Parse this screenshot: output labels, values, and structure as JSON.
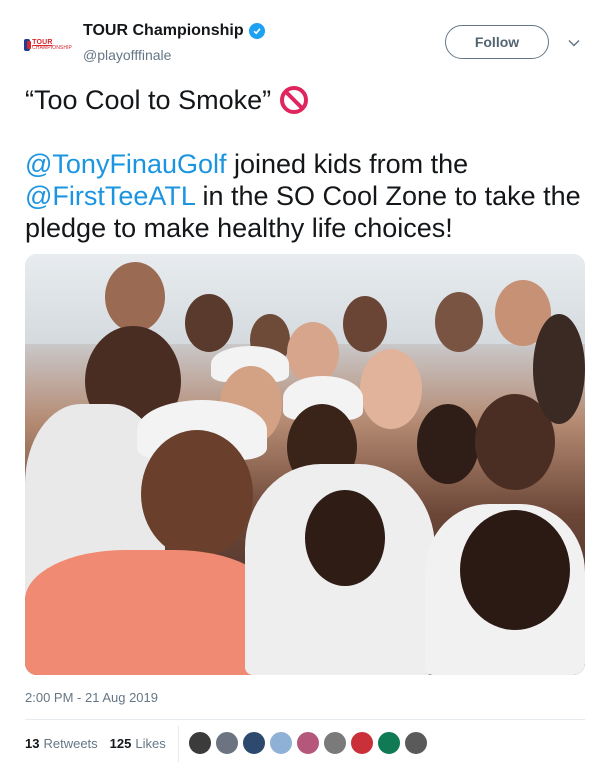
{
  "account": {
    "display_name": "TOUR Championship",
    "handle": "@playofffinale",
    "avatar_logo_top": "TOUR",
    "avatar_logo_bottom": "CHAMPIONSHIP"
  },
  "follow_label": "Follow",
  "tweet": {
    "headline": "“Too Cool to Smoke”",
    "body_parts": [
      {
        "text": "@TonyFinauGolf",
        "type": "mention"
      },
      {
        "text": " joined kids from the ",
        "type": "text"
      },
      {
        "text": "@FirstTeeATL",
        "type": "mention"
      },
      {
        "text": " in the SO Cool Zone to take the pledge to make healthy life choices!",
        "type": "text"
      }
    ]
  },
  "timestamp": "2:00 PM - 21 Aug 2019",
  "stats": {
    "retweets_count": "13",
    "retweets_label": "Retweets",
    "likes_count": "125",
    "likes_label": "Likes"
  },
  "liker_avatars": [
    "#3b3b3b",
    "#6b7480",
    "#2d4a6e",
    "#8fb1d6",
    "#b5577a",
    "#7a7a7a",
    "#c9303a",
    "#0f7a54",
    "#5a5a5a"
  ],
  "colors": {
    "accent": "#1b95e0",
    "verified": "#1da1f2",
    "no_smoking": "#e0245e"
  }
}
